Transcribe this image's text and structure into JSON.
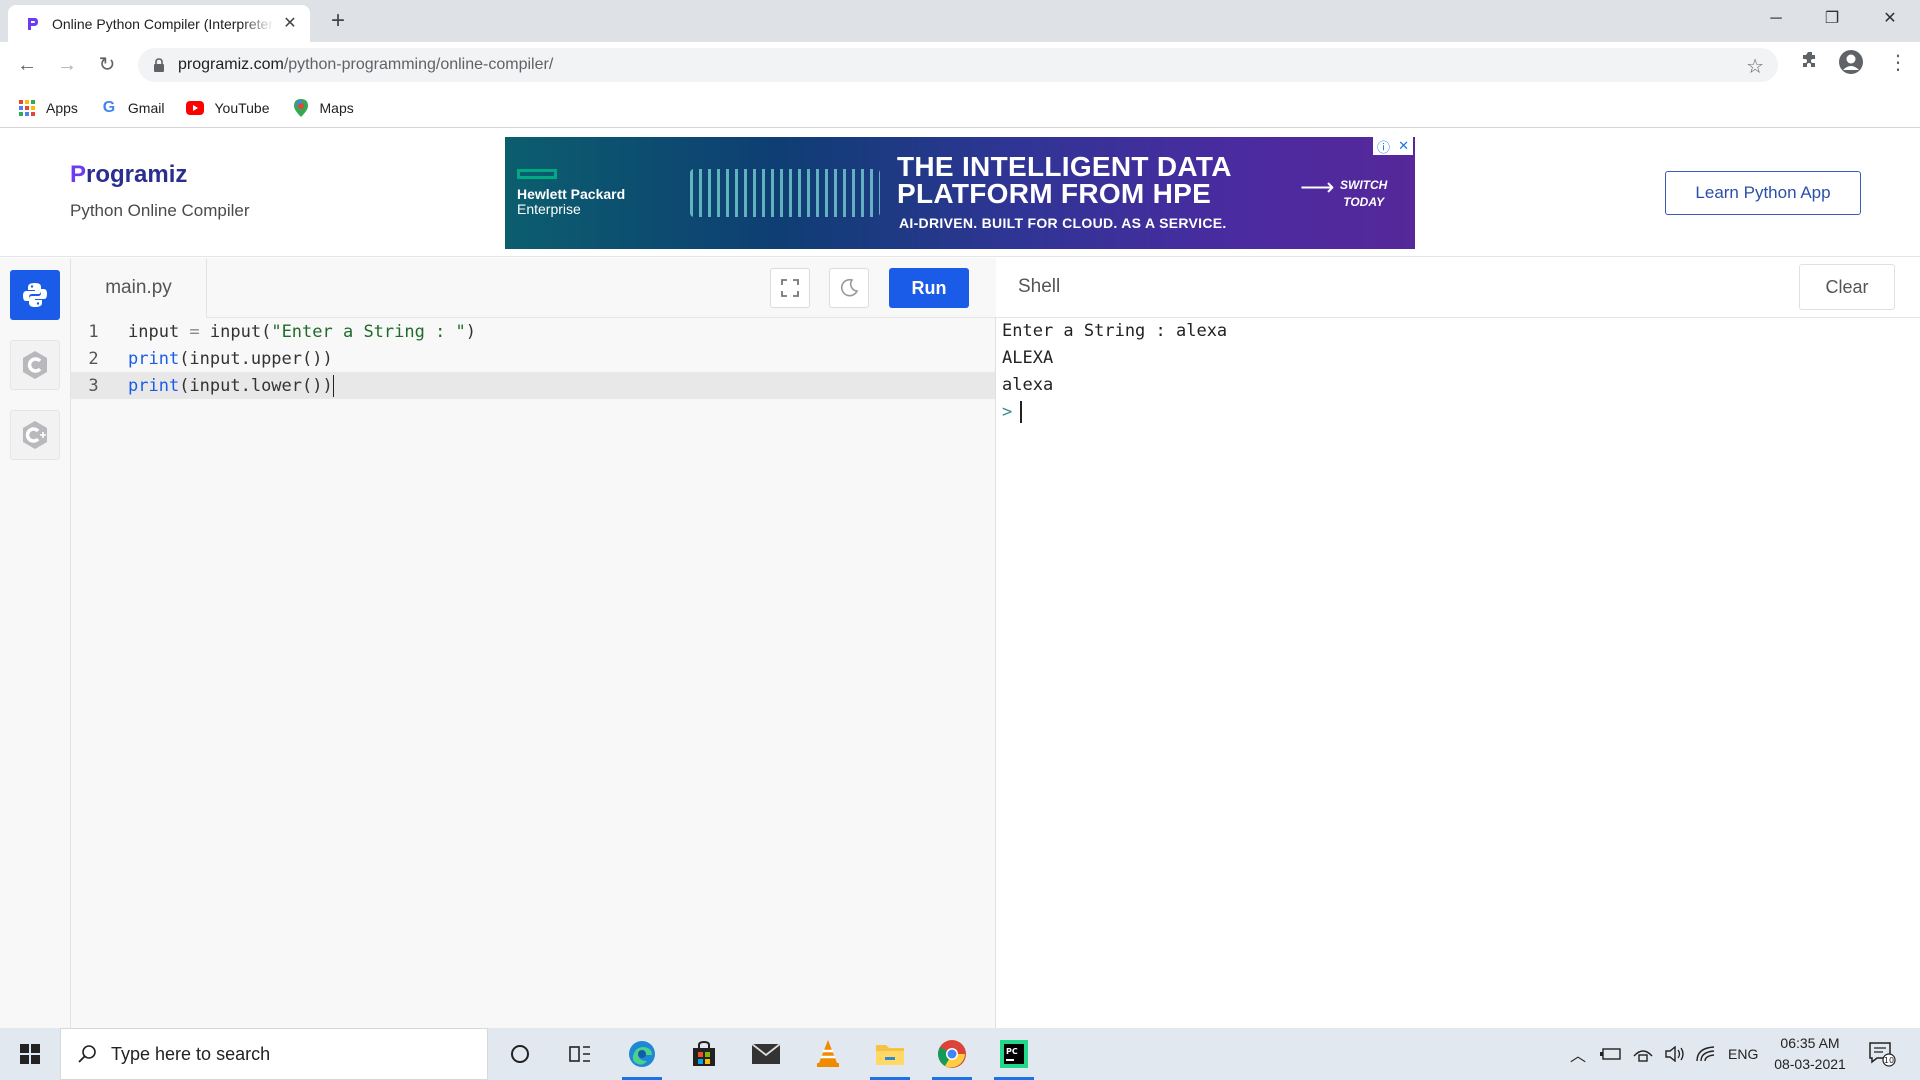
{
  "browser": {
    "tab_title": "Online Python Compiler (Interpreter)",
    "url_host": "programiz.com",
    "url_path": "/python-programming/online-compiler/",
    "bookmarks": [
      {
        "label": "Apps",
        "icon": "apps-grid-icon"
      },
      {
        "label": "Gmail",
        "icon": "google-g-icon"
      },
      {
        "label": "YouTube",
        "icon": "youtube-icon"
      },
      {
        "label": "Maps",
        "icon": "maps-icon"
      }
    ]
  },
  "site": {
    "logo": "rogramiz",
    "logo_initial": "P",
    "subtitle": "Python Online Compiler",
    "learn_button": "Learn Python App",
    "ad": {
      "brand_line1": "Hewlett Packard",
      "brand_line2": "Enterprise",
      "headline_line1": "THE INTELLIGENT DATA",
      "headline_line2": "PLATFORM FROM HPE",
      "tagline": "AI-DRIVEN. BUILT FOR CLOUD. AS A SERVICE.",
      "cta_line1": "SWITCH",
      "cta_line2": "TODAY"
    }
  },
  "editor": {
    "file_name": "main.py",
    "run_label": "Run",
    "lines": [
      {
        "num": "1",
        "parts": [
          "input ",
          "= ",
          "input(",
          "\"Enter a String : \"",
          ")"
        ]
      },
      {
        "num": "2",
        "parts": [
          "print",
          "(input.upper())"
        ]
      },
      {
        "num": "3",
        "parts": [
          "print",
          "(input.lower())"
        ]
      }
    ]
  },
  "shell": {
    "title": "Shell",
    "clear_label": "Clear",
    "output": [
      "Enter a String : alexa",
      "ALEXA",
      "alexa"
    ],
    "prompt": ">"
  },
  "taskbar": {
    "search_placeholder": "Type here to search",
    "language": "ENG",
    "time": "06:35 AM",
    "date": "08-03-2021",
    "notification_count": "10"
  },
  "colors": {
    "accent": "#1a5ce8",
    "keyword": "#1a5ce8",
    "string": "#1e6b2a"
  }
}
